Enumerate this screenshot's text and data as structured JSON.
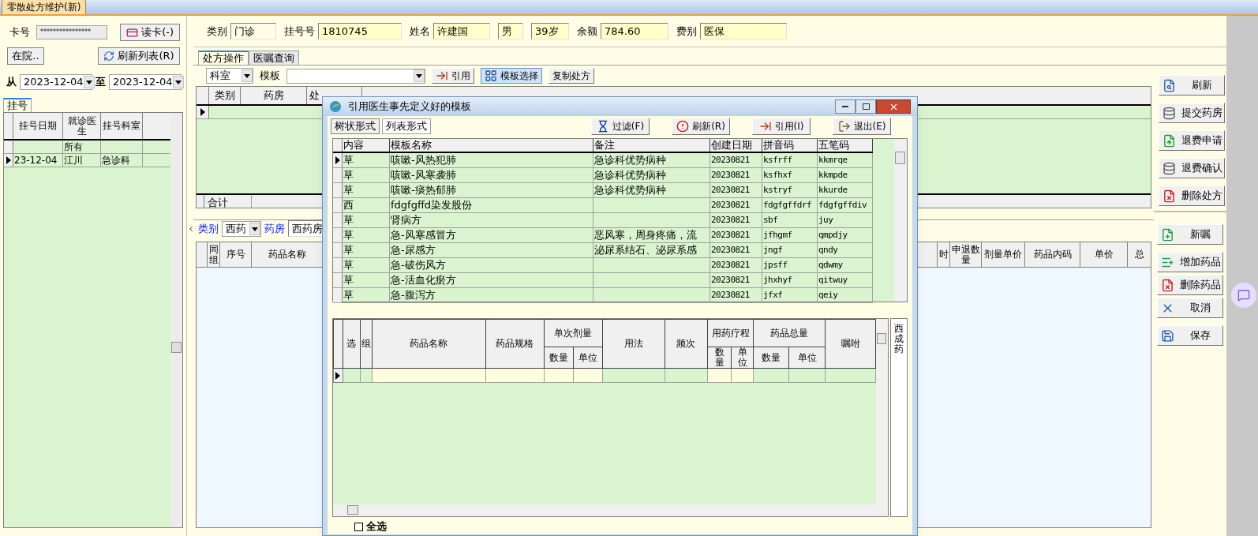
{
  "window": {
    "tab": "零散处方维护(新)"
  },
  "left_panel": {
    "card_label": "卡号",
    "card_value": "****************",
    "read_card_button": "读卡(-)",
    "in_hospital_button": "在院..",
    "refresh_list_button": "刷新列表(R)",
    "from_label": "从",
    "from_date": "2023-12-04",
    "to_label": "至",
    "to_date": "2023-12-04",
    "tabs": [
      {
        "label": "挂号",
        "selected": true
      }
    ],
    "table": {
      "columns": [
        "挂号日期",
        "就诊医生",
        "挂号科室"
      ],
      "rows": [
        {
          "cells": [
            "",
            "所有",
            ""
          ],
          "selected": false
        },
        {
          "cells": [
            "23-12-04",
            "江川",
            "急诊科"
          ],
          "selected": true
        }
      ]
    }
  },
  "patient": [
    {
      "label": "类别",
      "value": "门诊"
    },
    {
      "label": "挂号号",
      "value": "1810745"
    },
    {
      "label": "姓名",
      "value": "许建国"
    },
    {
      "value": "男"
    },
    {
      "value": "39岁"
    },
    {
      "label": "余额",
      "value": "784.60"
    },
    {
      "label": "费别",
      "value": "医保"
    }
  ],
  "tabs": [
    {
      "label": "处方操作",
      "selected": true
    },
    {
      "label": "医嘱查询",
      "selected": false
    }
  ],
  "toolbar": {
    "dept_select": "科室",
    "template_label": "模板",
    "buttons": [
      {
        "label": "引用",
        "kind": "apply",
        "pressed": false
      },
      {
        "label": "模板选择",
        "kind": "grid",
        "pressed": true
      },
      {
        "label": "复制处方",
        "kind": "none",
        "pressed": false
      }
    ]
  },
  "prescription_table": {
    "columns": [
      "类别",
      "药房",
      "处"
    ],
    "footer": "合计"
  },
  "drug_filter": {
    "category_label": "类别",
    "category": "西药",
    "pharmacy_label": "药房",
    "pharmacy": "西药房"
  },
  "orders_table": {
    "columns_left": [
      "同组",
      "序号",
      "药品名称"
    ],
    "columns_right": [
      "时",
      "申退数量",
      "剂量单价",
      "药品内码",
      "单价",
      "总"
    ]
  },
  "side_buttons_top": [
    {
      "label": "刷新",
      "kind": "search"
    },
    {
      "label": "提交药房",
      "kind": "submit"
    },
    {
      "label": "退费申请",
      "kind": "upload"
    },
    {
      "label": "退费确认",
      "kind": "submit"
    },
    {
      "label": "删除处方",
      "kind": "delete"
    }
  ],
  "side_buttons_bottom": [
    {
      "label": "新嘱",
      "kind": "add"
    },
    {
      "label": "增加药品",
      "kind": "addlist"
    },
    {
      "label": "删除药品",
      "kind": "delete"
    },
    {
      "label": "取消",
      "kind": "cancel"
    },
    {
      "label": "保存",
      "kind": "save"
    }
  ],
  "dialog": {
    "title": "引用医生事先定义好的模板",
    "tabs": [
      {
        "label": "树状形式",
        "selected": false
      },
      {
        "label": "列表形式",
        "selected": true
      }
    ],
    "buttons": [
      {
        "label": "过滤(F)",
        "kind": "filter"
      },
      {
        "label": "刷新(R)",
        "kind": "refresh"
      },
      {
        "label": "引用(I)",
        "kind": "apply"
      },
      {
        "label": "退出(E)",
        "kind": "exit"
      }
    ],
    "templates": {
      "columns": [
        "内容",
        "模板名称",
        "备注",
        "创建日期",
        "拼音码",
        "五笔码"
      ],
      "rows": [
        {
          "cells": [
            "草",
            "咳嗽-风热犯肺",
            "急诊科优势病种",
            "20230821",
            "ksfrff",
            "kkmrqe"
          ],
          "selected": true
        },
        {
          "cells": [
            "草",
            "咳嗽-风寒袭肺",
            "急诊科优势病种",
            "20230821",
            "ksfhxf",
            "kkmpde"
          ],
          "selected": false
        },
        {
          "cells": [
            "草",
            "咳嗽-痰热郁肺",
            "急诊科优势病种",
            "20230821",
            "kstryf",
            "kkurde"
          ],
          "selected": false
        },
        {
          "cells": [
            "西",
            "fdgfgffd染发股份",
            "",
            "20230821",
            "fdgfgffdrf",
            "fdgfgffdiv"
          ],
          "selected": false
        },
        {
          "cells": [
            "草",
            "肾病方",
            "",
            "20230821",
            "sbf",
            "juy"
          ],
          "selected": false
        },
        {
          "cells": [
            "草",
            "急-风寒感冒方",
            "恶风寒，周身疼痛，流",
            "20230821",
            "jfhgmf",
            "qmpdjy"
          ],
          "selected": false
        },
        {
          "cells": [
            "草",
            "急-尿感方",
            "泌尿系结石、泌尿系感",
            "20230821",
            "jngf",
            "qndy"
          ],
          "selected": false
        },
        {
          "cells": [
            "草",
            "急-破伤风方",
            "",
            "20230821",
            "jpsff",
            "qdwmy"
          ],
          "selected": false
        },
        {
          "cells": [
            "草",
            "急-活血化瘀方",
            "",
            "20230821",
            "jhxhyf",
            "qitwuy"
          ],
          "selected": false
        },
        {
          "cells": [
            "草",
            "急-腹泻方",
            "",
            "20230821",
            "jfxf",
            "qeiy"
          ],
          "selected": false
        }
      ]
    },
    "detail": {
      "columns": [
        {
          "label": "选"
        },
        {
          "label": "组"
        },
        {
          "label": "药品名称"
        },
        {
          "label": "药品规格"
        },
        {
          "label": "单次剂量",
          "children": [
            "数量",
            "单位"
          ]
        },
        {
          "label": "用法"
        },
        {
          "label": "频次"
        },
        {
          "label": "用药疗程",
          "children": [
            "数量",
            "单位"
          ]
        },
        {
          "label": "药品总量",
          "children": [
            "数量",
            "单位"
          ]
        },
        {
          "label": "嘱咐"
        }
      ]
    },
    "side_tab": "西成药",
    "select_all": {
      "label": "全选",
      "checked": false
    }
  }
}
